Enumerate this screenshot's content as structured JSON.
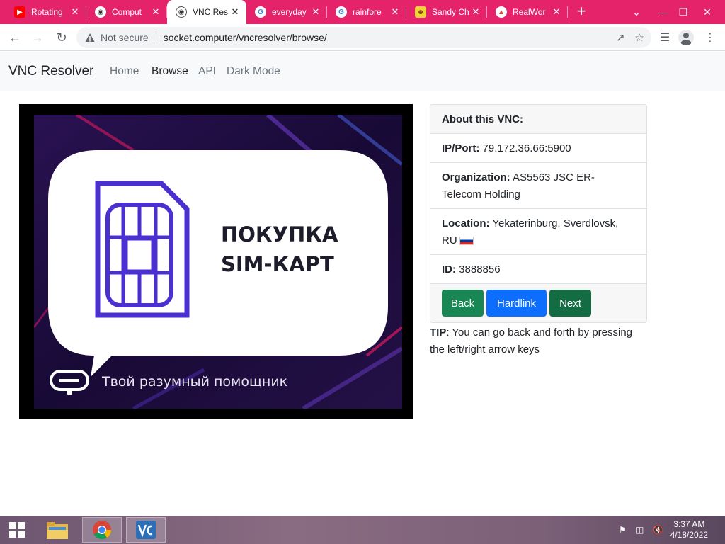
{
  "browser": {
    "tabs": [
      {
        "title": "Rotating",
        "icon": "youtube-icon"
      },
      {
        "title": "Comput",
        "icon": "computer-vision-icon"
      },
      {
        "title": "VNC Res",
        "icon": "vnc-resolver-icon",
        "active": true
      },
      {
        "title": "everyday",
        "icon": "google-icon"
      },
      {
        "title": "rainfore",
        "icon": "google-icon"
      },
      {
        "title": "Sandy Ch",
        "icon": "sandy-icon"
      },
      {
        "title": "RealWor",
        "icon": "realworld-icon"
      }
    ],
    "new_tab": "+",
    "address": {
      "security": "Not secure",
      "url": "socket.computer/vncresolver/browse/"
    }
  },
  "site": {
    "brand": "VNC Resolver",
    "nav": [
      "Home",
      "Browse",
      "API",
      "Dark Mode"
    ],
    "active_nav": "Browse"
  },
  "vnc": {
    "headline_line1": "ПОКУПКА",
    "headline_line2": "SIM-КАРТ",
    "tagline": "Твой разумный помощник"
  },
  "about": {
    "title": "About this VNC:",
    "ip_label": "IP/Port:",
    "ip_value": "79.172.36.66:5900",
    "org_label": "Organization:",
    "org_value_line1": "AS5563 JSC ER-",
    "org_value_line2": "Telecom Holding",
    "loc_label": "Location:",
    "loc_value_line1": "Yekaterinburg, Sverdlovsk,",
    "loc_value_line2": "RU",
    "id_label": "ID:",
    "id_value": "3888856",
    "buttons": {
      "back": "Back",
      "hardlink": "Hardlink",
      "next": "Next"
    }
  },
  "tip": {
    "label": "TIP",
    "text_line1": ": You can go back and forth by pressing",
    "text_line2": "the left/right arrow keys"
  },
  "taskbar": {
    "time": "3:37 AM",
    "date": "4/18/2022",
    "apps": [
      "start-button",
      "file-explorer",
      "chrome",
      "vnc-viewer"
    ]
  },
  "colors": {
    "tabstrip": "#e5236b",
    "btn_back": "#198754",
    "btn_hardlink": "#0d6efd",
    "btn_next": "#146c43"
  }
}
